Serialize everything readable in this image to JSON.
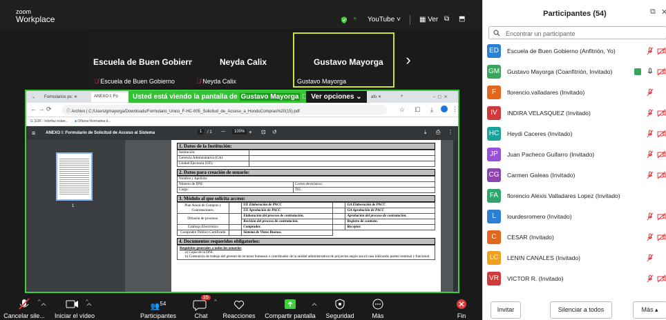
{
  "app": {
    "brand_top": "zoom",
    "brand_bottom": "Workplace"
  },
  "topbar": {
    "youtube": "YouTube ˅",
    "view": "Ver"
  },
  "tiles": [
    {
      "name": "Escuela de Buen Gobierno",
      "label": "Escuela de Buen Gobierno",
      "muted": true
    },
    {
      "name": "Neyda Calix",
      "label": "Neyda Calix",
      "muted": true
    },
    {
      "name": "Gustavo Mayorga",
      "label": "Gustavo Mayorga",
      "muted": false
    }
  ],
  "share": {
    "banner_prefix": "Usted está viendo la pantalla de",
    "banner_name": "Gustavo Mayorga",
    "view_options": "Ver opciones",
    "tabs": [
      "Formularios ps: ✕",
      "ANEXO I: Fo",
      "afo ✕"
    ],
    "url_label": "Archivo",
    "url": "C:/Users/gmayorga/Downloads/Formulario_Unico_F-HC-005_Solicitud_de_Acceso_a_HonduCompras%20(15).pdf",
    "bookmarks": [
      "SUR - Interfaz estan...",
      "Oficina Normativa d..."
    ],
    "pdf_title": "ANEXO I: Formulario de Solicitud de Acceso al Sistema",
    "page_current": "1",
    "page_total": "/ 1",
    "zoom": "100%",
    "thumb_label": "1"
  },
  "doc": {
    "s1": "1. Datos de la Institución:",
    "s1_rows": [
      "Institución:",
      "Gerencia Administrativa (GA):",
      "Unidad Ejecutora (UE):"
    ],
    "s2": "2. Datos para creación de usuario:",
    "s2_name": "Nombre y Apellido:",
    "s2_dni": "Número de DNI:",
    "s2_email": "Correo electrónico:",
    "s2_cargo": "Cargo:",
    "s2_tel": "TEL:",
    "s3": "3. Módulo al que solicita acceso:",
    "m_plan": "Plan Anual de Compras y Contrataciones.",
    "m_plan1": "UE Elaboración de PACC",
    "m_plan2": "GA Elaboración de PACC",
    "m_plan3": "UE Aprobación de PACC",
    "m_plan4": "GA Aprobación de PACC",
    "m_dif": "Difusión de procesos.",
    "m_dif1": "Elaboración del proceso de contratación.",
    "m_dif2": "Aprobación del proceso de contratación.",
    "m_dif3": "Revisión del proceso de contratación.",
    "m_dif4": "Registro de contrato.",
    "m_cat": "Catálogo Electrónico",
    "m_cat1": "Comprador.",
    "m_cat2": "Receptor.",
    "m_cert": "Comprador Público Certificado",
    "m_cert1": "Sistema de Vistos Buenos.",
    "s4": "4. Documentos requeridos obligatorios:",
    "s4_h": "Requisitos generales a todos los usuarios",
    "s4_a": "a)    Copia de la DNI.",
    "s4_b": "b)    Constancia de trabajo del gerente de recursos humanos o coordinador de la unidad administradora de proyectos según sea el caso indicando puesto nominal y funcional."
  },
  "controls": {
    "mute": "Cancelar sile...",
    "video": "Iniciar el vídeo",
    "participants": "Participantes",
    "participants_count": "54",
    "chat": "Chat",
    "chat_badge": "15",
    "reactions": "Reacciones",
    "share": "Compartir pantalla",
    "security": "Seguridad",
    "more": "Más",
    "end": "Fin"
  },
  "panel": {
    "title": "Participantes (54)",
    "search_placeholder": "Encontrar un participante",
    "participants": [
      {
        "initials": "ED",
        "name": "Escuela de Buen Gobierno (Anfitrión, Yo)",
        "color": "#2d7fd2",
        "mic_muted": true,
        "cam_off": true,
        "sharing": false
      },
      {
        "initials": "GM",
        "name": "Gustavo Mayorga (Coanfitrión, Invitado)",
        "color": "#3ba55c",
        "mic_muted": false,
        "cam_off": true,
        "sharing": true
      },
      {
        "initials": "F",
        "name": "florencio.valladares (Invitado)",
        "color": "#e2661e",
        "mic_muted": true,
        "cam_off": false,
        "sharing": false
      },
      {
        "initials": "IV",
        "name": "INDIRA VELASQUEZ (Invitado)",
        "color": "#d23a3a",
        "mic_muted": true,
        "cam_off": true,
        "sharing": false
      },
      {
        "initials": "HC",
        "name": "Heydi Caceres (Invitado)",
        "color": "#1aa39a",
        "mic_muted": true,
        "cam_off": true,
        "sharing": false
      },
      {
        "initials": "JP",
        "name": "Juan Pacheco Guifarro (Invitado)",
        "color": "#9a4fd8",
        "mic_muted": true,
        "cam_off": true,
        "sharing": false
      },
      {
        "initials": "CG",
        "name": "Carmen Galeas (Invitado)",
        "color": "#8e44ad",
        "mic_muted": true,
        "cam_off": true,
        "sharing": false
      },
      {
        "initials": "FA",
        "name": "florencio Alexis Valladares Lopez (Invitado)",
        "color": "#2ea56a",
        "mic_muted": false,
        "cam_off": false,
        "sharing": false
      },
      {
        "initials": "L",
        "name": "lourdesromero (Invitado)",
        "color": "#2d7fd2",
        "mic_muted": true,
        "cam_off": true,
        "sharing": false
      },
      {
        "initials": "C",
        "name": "CESAR (Invitado)",
        "color": "#e2661e",
        "mic_muted": true,
        "cam_off": true,
        "sharing": false
      },
      {
        "initials": "LC",
        "name": "LENIN CANALES (Invitado)",
        "color": "#f0a020",
        "mic_muted": true,
        "cam_off": false,
        "sharing": false
      },
      {
        "initials": "VR",
        "name": "VICTOR R. (Invitado)",
        "color": "#d23a3a",
        "mic_muted": true,
        "cam_off": true,
        "sharing": false
      }
    ],
    "invite": "Invitar",
    "mute_all": "Silenciar a todos",
    "more": "Más ▴"
  }
}
